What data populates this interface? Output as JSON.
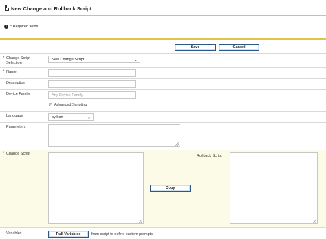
{
  "header": {
    "title": "New Change and Rollback Script"
  },
  "info": {
    "required_text": "* Required fields"
  },
  "buttons": {
    "save": "Save",
    "cancel": "Cancel",
    "copy": "Copy",
    "pull_variables": "Pull Variables"
  },
  "form": {
    "change_script_selection": {
      "label": "Change Script Selection",
      "value": "New Change Script"
    },
    "name": {
      "label": "Name",
      "value": ""
    },
    "description": {
      "label": "Description",
      "value": ""
    },
    "device_family": {
      "label": "Device Family",
      "placeholder": "Any Device Family"
    },
    "advanced_scripting": {
      "label": "Advanced Scripting",
      "checked": true
    },
    "language": {
      "label": "Language",
      "value": "python"
    },
    "parameters": {
      "label": "Parameters"
    },
    "change_script": {
      "label": "Change Script"
    },
    "rollback_script": {
      "label": "Rollback Script"
    },
    "variables": {
      "label": "Variables",
      "hint": "from script to define custom prompts."
    }
  },
  "colors": {
    "accent_yellow": "#e2c44a",
    "required_red": "#c8102e",
    "button_border": "#2a5a8c",
    "cream_panel": "#fbfbe7"
  }
}
